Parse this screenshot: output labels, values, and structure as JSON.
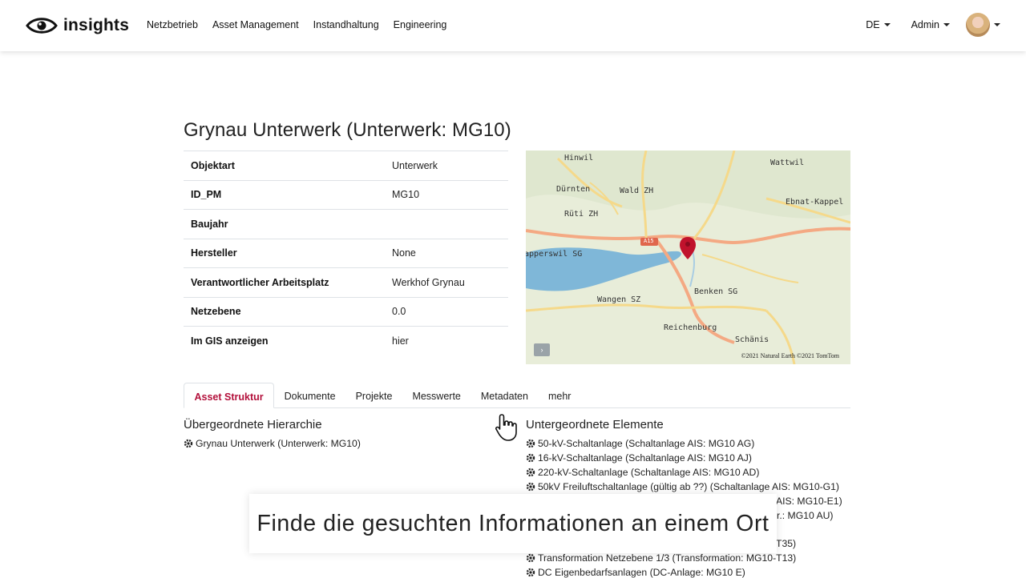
{
  "brand": {
    "name": "insights"
  },
  "nav": {
    "links": [
      "Netzbetrieb",
      "Asset Management",
      "Instandhaltung",
      "Engineering"
    ]
  },
  "header_right": {
    "language": "DE",
    "user_menu": "Admin"
  },
  "page": {
    "title": "Grynau Unterwerk (Unterwerk: MG10)"
  },
  "details": [
    {
      "key": "Objektart",
      "value": "Unterwerk"
    },
    {
      "key": "ID_PM",
      "value": "MG10"
    },
    {
      "key": "Baujahr",
      "value": ""
    },
    {
      "key": "Hersteller",
      "value": "None"
    },
    {
      "key": "Verantwortlicher Arbeitsplatz",
      "value": "Werkhof Grynau"
    },
    {
      "key": "Netzebene",
      "value": "0.0"
    },
    {
      "key": "Im GIS anzeigen",
      "value": "hier"
    }
  ],
  "map": {
    "labels": [
      "Hinwil",
      "Wattwil",
      "Dürnten",
      "Wald ZH",
      "Ebnat-Kappel",
      "Rüti ZH",
      "A15",
      "Rapperswil SG",
      "Benken SG",
      "Wangen SZ",
      "Reichenburg",
      "Schänis"
    ],
    "attribution": "©2021 Natural Earth ©2021 TomTom",
    "colors": {
      "water": "#7fb7d8",
      "land": "#e7ecd9",
      "road_major": "#f4a983",
      "road_minor": "#f5d98a",
      "marker": "#c0122c"
    }
  },
  "tabs": {
    "items": [
      "Asset Struktur",
      "Dokumente",
      "Projekte",
      "Messwerte",
      "Metadaten",
      "mehr"
    ],
    "active": "Asset Struktur",
    "active_color": "#b3103b"
  },
  "hierarchy": {
    "title": "Übergeordnete Hierarchie",
    "items": [
      "Grynau Unterwerk (Unterwerk: MG10)"
    ]
  },
  "children": {
    "title": "Untergeordnete Elemente",
    "items": [
      "50-kV-Schaltanlage (Schaltanlage AIS: MG10 AG)",
      "16-kV-Schaltanlage (Schaltanlage AIS: MG10 AJ)",
      "220-kV-Schaltanlage (Schaltanlage AIS: MG10 AD)",
      "50kV Freiluftschaltanlage (gültig ab ??) (Schaltanlage AIS: MG10-G1)",
      "AIS: MG10-E1)",
      "r.: MG10 AU)",
      "T35)",
      "Transformation Netzebene 1/3 (Transformation: MG10-T13)",
      "DC Eigenbedarfsanlagen (DC-Anlage: MG10 E)"
    ]
  },
  "caption": {
    "text": "Finde die gesuchten Informationen an einem Ort"
  }
}
